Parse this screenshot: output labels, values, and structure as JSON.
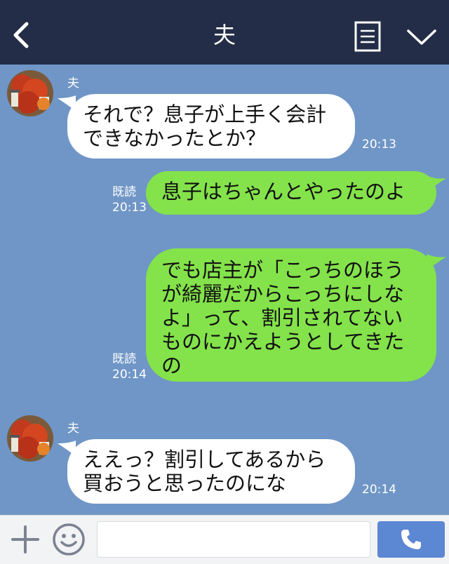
{
  "header": {
    "title": "夫",
    "icons": {
      "back": "chevron-left-icon",
      "memo": "memo-icon",
      "dropdown": "chevron-down-icon"
    }
  },
  "messages": [
    {
      "direction": "incoming",
      "sender": "夫",
      "lines": [
        "それで？息子が上手く会計",
        "できなかったとか？"
      ],
      "time": "20:13"
    },
    {
      "direction": "outgoing",
      "lines": [
        "息子はちゃんとやったのよ"
      ],
      "read": "既読",
      "time": "20:13"
    },
    {
      "direction": "outgoing",
      "lines": [
        "でも店主が「こっちのほう",
        "が綺麗だからこっちにしな",
        "よ」って、割引されてない",
        "ものにかえようとしてきた",
        "の"
      ],
      "read": "既読",
      "time": "20:14"
    },
    {
      "direction": "incoming",
      "sender": "夫",
      "lines": [
        "ええっ？割引してあるから",
        "買おうと思ったのにな"
      ],
      "time": "20:14"
    }
  ],
  "footer": {
    "input_value": "",
    "icons": {
      "plus": "plus-icon",
      "emoji": "smiley-icon",
      "call": "phone-icon"
    }
  },
  "colors": {
    "header_bg": "#232d47",
    "chat_bg": "#6f96c6",
    "incoming_bubble": "#ffffff",
    "outgoing_bubble": "#84e24b",
    "call_button": "#5b87d3"
  }
}
